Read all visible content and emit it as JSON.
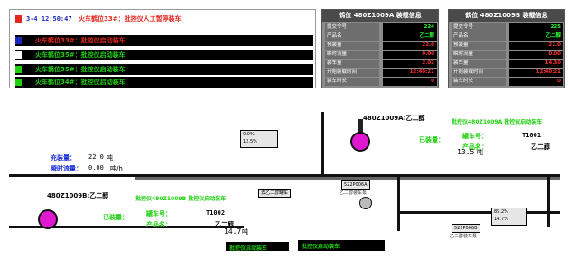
{
  "alarms": [
    {
      "time": "3-4 12:50:47",
      "message": "火车鹤位33#：批控仪人工暂停装车",
      "color": "#e3261e",
      "marker": "#e3261e",
      "dark": false
    },
    {
      "time": "",
      "message": "火车鹤位33#：批控仪启动装车",
      "color": "#e3261e",
      "marker": "#1b26b8",
      "dark": true
    },
    {
      "time": "",
      "message": "火车鹤位35#：批控仪启动装车",
      "color": "#1fd00f",
      "marker": "#ffffff",
      "dark": true
    },
    {
      "time": "",
      "message": "火车鹤位35#：批控仪启动装车",
      "color": "#1fd00f",
      "marker": "#1fd00f",
      "dark": true
    },
    {
      "time": "",
      "message": "火车鹤位34#：批控仪启动装车",
      "color": "#1fd00f",
      "marker": "#1fd00f",
      "dark": true
    }
  ],
  "status_a": {
    "title": "鹤位 480Z1009A 装载信息",
    "rows": [
      {
        "label": "提交令号",
        "value": "224",
        "color": "#2bff2b"
      },
      {
        "label": "产品名",
        "value": "乙二醇",
        "color": "#2bff2b"
      },
      {
        "label": "预装量",
        "value": "22.0",
        "color": "#ff3030"
      },
      {
        "label": "瞬时流量",
        "value": "0.00",
        "color": "#ff3030"
      },
      {
        "label": "装车量",
        "value": "2.02",
        "color": "#ff3030"
      },
      {
        "label": "开始装载时间",
        "value": "12:40:21",
        "color": "#ff3030"
      },
      {
        "label": "装车时长",
        "value": "0",
        "color": "#ff3030"
      }
    ]
  },
  "status_b": {
    "title": "鹤位 480Z1009B 装载信息",
    "rows": [
      {
        "label": "提交令号",
        "value": "225",
        "color": "#2bff2b"
      },
      {
        "label": "产品名",
        "value": "乙二醇",
        "color": "#2bff2b"
      },
      {
        "label": "预装量",
        "value": "22.0",
        "color": "#ff3030"
      },
      {
        "label": "瞬时流量",
        "value": "0.00",
        "color": "#ff3030"
      },
      {
        "label": "装车量",
        "value": "14.30",
        "color": "#ff3030"
      },
      {
        "label": "开始装载时间",
        "value": "12:40:21",
        "color": "#ff3030"
      },
      {
        "label": "装车时长",
        "value": "0",
        "color": "#ff3030"
      }
    ]
  },
  "station_a": {
    "title": "480Z1009A:乙二醇",
    "status": "批控仪480Z1009A 批控仪启动装车",
    "loaded_label": "已装量：",
    "tank_label": "罐车号：",
    "tank_no": "T1001",
    "product_label": "产品名：",
    "product": "乙二醇",
    "amount": "13.5",
    "unit": "吨",
    "level_a": "0.0%",
    "level_b": "12.5%"
  },
  "station_b": {
    "title": "480Z1009B:乙二醇",
    "status": "批控仪480Z1009B 批控仪启动装车",
    "loaded_label": "已装量：",
    "tank_label": "罐车号：",
    "tank_no": "T1002",
    "product_label": "产品名：",
    "product": "乙二醇",
    "amount": "14.7",
    "unit": "吨",
    "level_a": "85.2%",
    "level_b": "14.7%"
  },
  "fill": {
    "preset_label": "充装量：",
    "preset_value": "22.0",
    "preset_unit": "吨",
    "flow_label": "瞬时流量：",
    "flow_value": "0.00",
    "flow_unit": "吨/h"
  },
  "tags": {
    "pump_a": "522P006A",
    "pump_b": "522P006B",
    "pump_a_desc": "乙二醇装车泵",
    "pump_b_desc": "乙二醇装车泵",
    "line": "去乙二醇罐车",
    "bottom_status_1": "批控仪启动装车",
    "bottom_status_2": "批控仪启动装车"
  }
}
